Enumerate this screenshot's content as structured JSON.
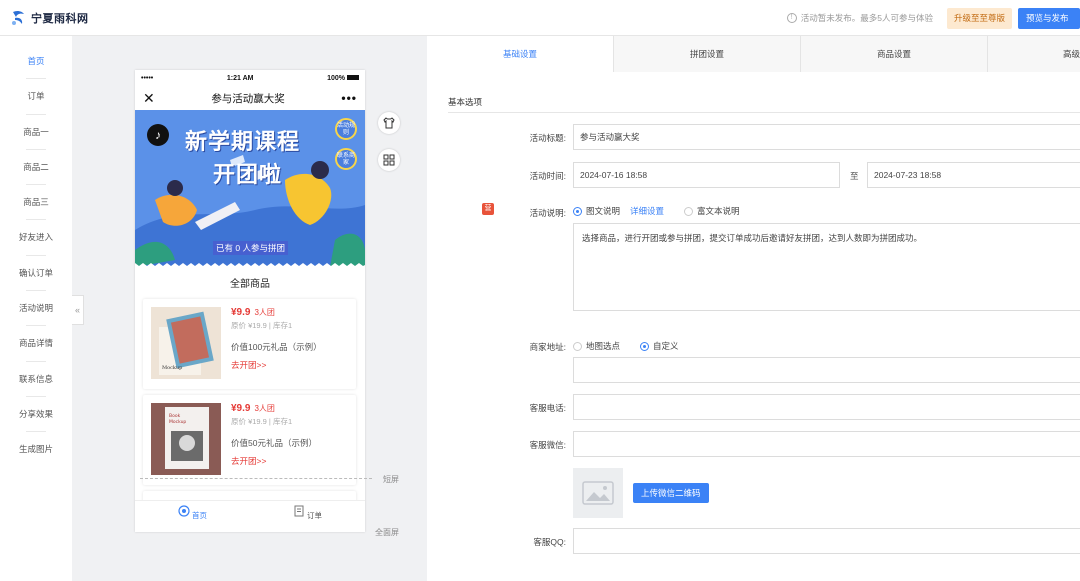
{
  "brand": {
    "name": "宁夏雨科网",
    "accent": "#3b82f6"
  },
  "topbar": {
    "notice": "活动暂未发布。最多5人可参与体验",
    "upgrade_label": "升级至至尊版",
    "publish_label": "预览与发布"
  },
  "nav": {
    "items": [
      {
        "label": "首页",
        "active": true
      },
      {
        "label": "订单"
      },
      {
        "label": "商品一"
      },
      {
        "label": "商品二"
      },
      {
        "label": "商品三"
      },
      {
        "label": "好友进入"
      },
      {
        "label": "确认订单"
      },
      {
        "label": "活动说明"
      },
      {
        "label": "商品详情"
      },
      {
        "label": "联系信息"
      },
      {
        "label": "分享效果"
      },
      {
        "label": "生成图片"
      }
    ],
    "collapse_glyph": "«"
  },
  "phone": {
    "status_left": "•••••",
    "status_time": "1:21 AM",
    "status_battery": "100%",
    "close_glyph": "✕",
    "title": "参与活动赢大奖",
    "more_glyph": "•••",
    "banner": {
      "line1": "新学期课程",
      "line2": "开团啦",
      "pill1": "活动规则",
      "pill2": "联系商家",
      "footer": "已有 0 人参与拼团"
    },
    "section_title": "全部商品",
    "products": [
      {
        "price": "¥9.9",
        "group": "3人团",
        "orig": "原价 ¥19.9 | 库存1",
        "gift": "价值100元礼品（示例）",
        "go": "去开团>>"
      },
      {
        "price": "¥9.9",
        "group": "3人团",
        "orig": "原价 ¥19.9 | 库存1",
        "gift": "价值50元礼品（示例）",
        "go": "去开团>>"
      }
    ],
    "tabbar": [
      {
        "label": "首页",
        "active": true
      },
      {
        "label": "订单"
      }
    ]
  },
  "preview": {
    "short_label": "短屏",
    "full_label": "全面屏"
  },
  "settings": {
    "tabs": [
      {
        "label": "基础设置",
        "active": true
      },
      {
        "label": "拼团设置"
      },
      {
        "label": "商品设置"
      },
      {
        "label": "高级"
      }
    ],
    "section": "基本选项",
    "fields": {
      "title_label": "活动标题:",
      "title_value": "参与活动赢大奖",
      "time_label": "活动时间:",
      "start_time": "2024-07-16 18:58",
      "to": "至",
      "end_time": "2024-07-23 18:58",
      "desc_tag": "营",
      "desc_label": "活动说明:",
      "desc_opt1": "图文说明",
      "desc_detail_link": "详细设置",
      "desc_opt2": "富文本说明",
      "desc_text": "选择商品，进行开团或参与拼团，提交订单成功后邀请好友拼团，达到人数即为拼团成功。",
      "addr_label": "商家地址:",
      "addr_opt1": "地图选点",
      "addr_opt2": "自定义",
      "phone_label": "客服电话:",
      "wechat_label": "客服微信:",
      "upload_label": "上传微信二维码",
      "qq_label": "客服QQ:"
    }
  }
}
